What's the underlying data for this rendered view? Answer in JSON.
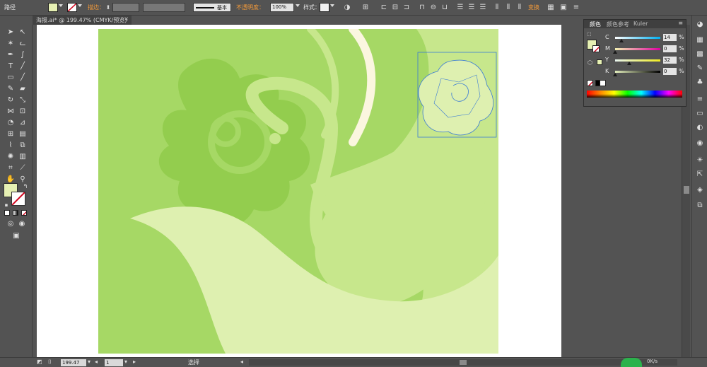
{
  "control_bar": {
    "object_label": "路径",
    "stroke_label": "描边：",
    "brush_name": "基本",
    "opacity_label": "不透明度：",
    "opacity_value": "100%",
    "style_label": "样式：",
    "transform_label": "变换",
    "fill_color": "#e6f0b3",
    "accent_label_color": "#f39a3a"
  },
  "document_tab": {
    "title": "海报.ai* @ 199.47% (CMYK/预览)",
    "close_icon": "close-icon"
  },
  "status_bar": {
    "zoom": "199.47",
    "page": "1",
    "tool_status": "选择",
    "perf_value": "0K/s"
  },
  "color_panel": {
    "tabs": [
      "颜色",
      "颜色参考",
      "Kuler"
    ],
    "sliders": [
      {
        "letter": "C",
        "value": "14",
        "unit": "%",
        "level": 0.14,
        "gradient": "linear-gradient(to right,#ffffff,#00aeef)"
      },
      {
        "letter": "M",
        "value": "0",
        "unit": "%",
        "level": 0.0,
        "gradient": "linear-gradient(to right,#f2f2b0,#e000a0)"
      },
      {
        "letter": "Y",
        "value": "32",
        "unit": "%",
        "level": 0.32,
        "gradient": "linear-gradient(to right,#e8f4f0,#f0ec20)"
      },
      {
        "letter": "K",
        "value": "0",
        "unit": "%",
        "level": 0.0,
        "gradient": "linear-gradient(to right,#e2eebc,#000000)"
      }
    ],
    "fill_color": "#e6f0b3"
  },
  "artwork_colors": {
    "background": "#a6d865",
    "dark_leaf": "#93cd4e",
    "mid_leaf": "#c7e78c",
    "light_leaf": "#def0b0",
    "cream_stroke": "#fbf6df",
    "selection": "#3a7bd5"
  }
}
